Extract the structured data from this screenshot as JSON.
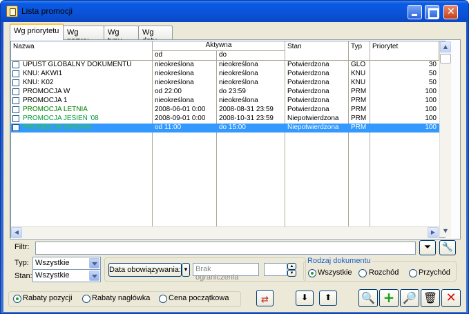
{
  "window": {
    "title": "Lista promocji"
  },
  "tabs": [
    {
      "label": "Wg priorytetu"
    },
    {
      "label": "Wg nazwy"
    },
    {
      "label": "Wg typu"
    },
    {
      "label": "Wg daty"
    }
  ],
  "grid": {
    "headers": {
      "nazwa": "Nazwa",
      "aktywna": "Aktywna",
      "od": "od",
      "do": "do",
      "stan": "Stan",
      "typ": "Typ",
      "priorytet": "Priorytet"
    },
    "rows": [
      {
        "nazwa": "UPUST GLOBALNY DOKUMENTU",
        "od": "nieokreślona",
        "do": "nieokreślona",
        "stan": "Potwierdzona",
        "typ": "GLO",
        "priorytet": "30"
      },
      {
        "nazwa": "KNU: AKWI1",
        "od": "nieokreślona",
        "do": "nieokreślona",
        "stan": "Potwierdzona",
        "typ": "KNU",
        "priorytet": "50"
      },
      {
        "nazwa": "KNU: K02",
        "od": "nieokreślona",
        "do": "nieokreślona",
        "stan": "Potwierdzona",
        "typ": "KNU",
        "priorytet": "50"
      },
      {
        "nazwa": "PROMOCJA W",
        "od": "od 22:00",
        "do": "do 23:59",
        "stan": "Potwierdzona",
        "typ": "PRM",
        "priorytet": "100"
      },
      {
        "nazwa": "PROMOCJA 1",
        "od": "nieokreślona",
        "do": "nieokreślona",
        "stan": "Potwierdzona",
        "typ": "PRM",
        "priorytet": "100"
      },
      {
        "nazwa": "PROMOCJA LETNIA",
        "od": "2008-06-01  0:00",
        "do": "2008-08-31 23:59",
        "stan": "Potwierdzona",
        "typ": "PRM",
        "priorytet": "100"
      },
      {
        "nazwa": "PROMOCJA JESIEŃ '08",
        "od": "2008-09-01  0:00",
        "do": "2008-10-31 23:59",
        "stan": "Niepotwierdzona",
        "typ": "PRM",
        "priorytet": "100"
      },
      {
        "nazwa": "PROMOCJA ZIMOWA",
        "od": "od 11:00",
        "do": "do 15:00",
        "stan": "Niepotwierdzona",
        "typ": "PRM",
        "priorytet": "100"
      }
    ]
  },
  "filter": {
    "label": "Filtr:",
    "value": ""
  },
  "typ": {
    "label": "Typ:",
    "value": "Wszystkie"
  },
  "stan": {
    "label": "Stan:",
    "value": "Wszystkie"
  },
  "data_obowiazywania": {
    "button_label": "Data obowiązywania:",
    "placeholder": "Brak ograniczenia"
  },
  "rodzaj": {
    "title": "Rodzaj dokumentu",
    "options": [
      "Wszystkie",
      "Rozchód",
      "Przychód"
    ]
  },
  "rabaty": {
    "options": [
      "Rabaty pozycji",
      "Rabaty nagłówka",
      "Cena początkowa"
    ]
  },
  "colors": {
    "selection": "#3399ff",
    "titlebar": "#0a5ae6"
  }
}
